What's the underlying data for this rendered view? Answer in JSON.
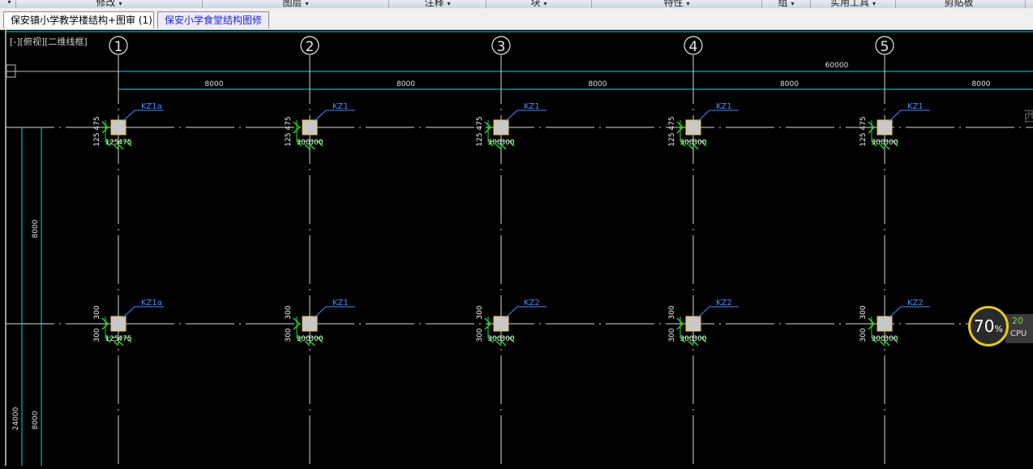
{
  "ribbon": {
    "items": [
      {
        "label": "",
        "arrow": "▾"
      },
      {
        "label": "修改",
        "arrow": "▾"
      },
      {
        "label": "图层",
        "arrow": "▾"
      },
      {
        "label": "注释",
        "arrow": "▾"
      },
      {
        "label": "块",
        "arrow": "▾"
      },
      {
        "label": "特性",
        "arrow": "▾"
      },
      {
        "label": "组",
        "arrow": "▾"
      },
      {
        "label": "实用工具",
        "arrow": "▾"
      },
      {
        "label": "剪贴板",
        "arrow": ""
      }
    ]
  },
  "tabs": [
    {
      "label": "保安镇小学教学楼结构+图审 (1)"
    },
    {
      "label": "保安小学食堂结构图修"
    }
  ],
  "view_label": "[-][俯视][二维线框]",
  "drawing": {
    "grid_labels": [
      "1",
      "2",
      "3",
      "4",
      "5"
    ],
    "overall_dim": "60000",
    "bay_dims": [
      "8000",
      "8000",
      "8000",
      "8000",
      "8000"
    ],
    "left_dims": {
      "bay_top": "8000",
      "bay_bottom": "8000",
      "total": "24000"
    },
    "row1": {
      "column_tags": [
        "KZ1a",
        "KZ1",
        "KZ1",
        "KZ1",
        "KZ1"
      ],
      "vertical_dims": [
        "125 475",
        "125 475",
        "125 475",
        "125 475",
        "125 475"
      ],
      "horizontal_dims": [
        [
          "125",
          "475"
        ],
        [
          "300",
          "300"
        ],
        [
          "300",
          "300"
        ],
        [
          "300",
          "300"
        ],
        [
          "300",
          "300"
        ]
      ]
    },
    "row2": {
      "column_tags": [
        "KZ1a",
        "KZ1",
        "KZ2",
        "KZ2",
        "KZ2"
      ],
      "vertical_dims": [
        [
          "300",
          "300"
        ],
        [
          "300",
          "300"
        ],
        [
          "300",
          "300"
        ],
        [
          "300",
          "300"
        ],
        [
          "300",
          "300"
        ]
      ],
      "horizontal_dims": [
        [
          "125",
          "475"
        ],
        [
          "300",
          "300"
        ],
        [
          "300",
          "300"
        ],
        [
          "300",
          "300"
        ],
        [
          "300",
          "300"
        ]
      ]
    }
  },
  "cpu_widget": {
    "percent": "70",
    "unit": "%",
    "small_value": "20",
    "label": "CPU"
  },
  "edge_text": "西",
  "colors": {
    "grid": "#d8d8d8",
    "dimension": "#00d8e8",
    "tag": "#4a8cff",
    "column": "#c8c8c8",
    "marker": "#22dd22"
  }
}
